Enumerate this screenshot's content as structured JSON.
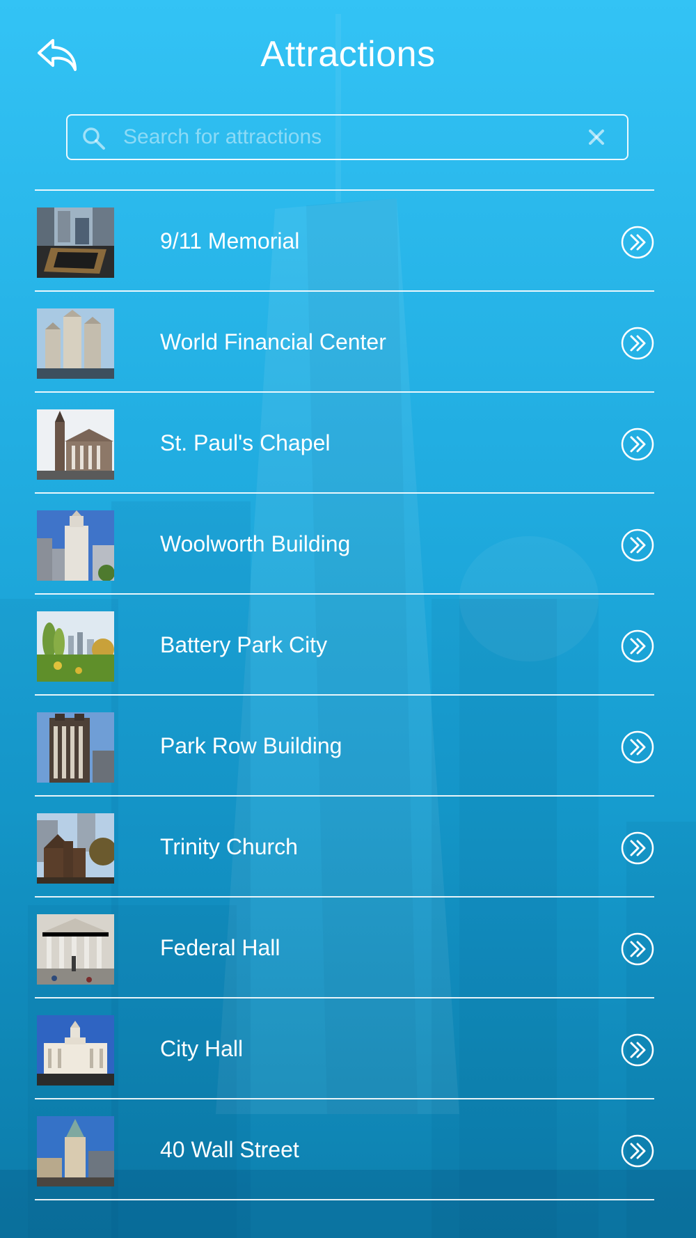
{
  "header": {
    "title": "Attractions",
    "back_icon": "reply-arrow-icon"
  },
  "search": {
    "placeholder": "Search for attractions",
    "value": "",
    "search_icon": "search-icon",
    "clear_icon": "close-icon"
  },
  "theme": {
    "accent": "#2ab9ee",
    "text": "#ffffff",
    "divider": "#ffffff"
  },
  "attractions": [
    {
      "label": "9/11 Memorial",
      "thumb_icon": "memorial-pool-thumbnail",
      "action_icon": "double-chevron-right-icon"
    },
    {
      "label": "World Financial Center",
      "thumb_icon": "towers-thumbnail",
      "action_icon": "double-chevron-right-icon"
    },
    {
      "label": "St. Paul's Chapel",
      "thumb_icon": "chapel-thumbnail",
      "action_icon": "double-chevron-right-icon"
    },
    {
      "label": "Woolworth Building",
      "thumb_icon": "skyscraper-thumbnail",
      "action_icon": "double-chevron-right-icon"
    },
    {
      "label": "Battery Park City",
      "thumb_icon": "park-thumbnail",
      "action_icon": "double-chevron-right-icon"
    },
    {
      "label": "Park Row Building",
      "thumb_icon": "building-thumbnail",
      "action_icon": "double-chevron-right-icon"
    },
    {
      "label": "Trinity Church",
      "thumb_icon": "church-thumbnail",
      "action_icon": "double-chevron-right-icon"
    },
    {
      "label": "Federal Hall",
      "thumb_icon": "columns-thumbnail",
      "action_icon": "double-chevron-right-icon"
    },
    {
      "label": "City Hall",
      "thumb_icon": "city-hall-thumbnail",
      "action_icon": "double-chevron-right-icon"
    },
    {
      "label": "40 Wall Street",
      "thumb_icon": "tower-thumbnail",
      "action_icon": "double-chevron-right-icon"
    }
  ]
}
